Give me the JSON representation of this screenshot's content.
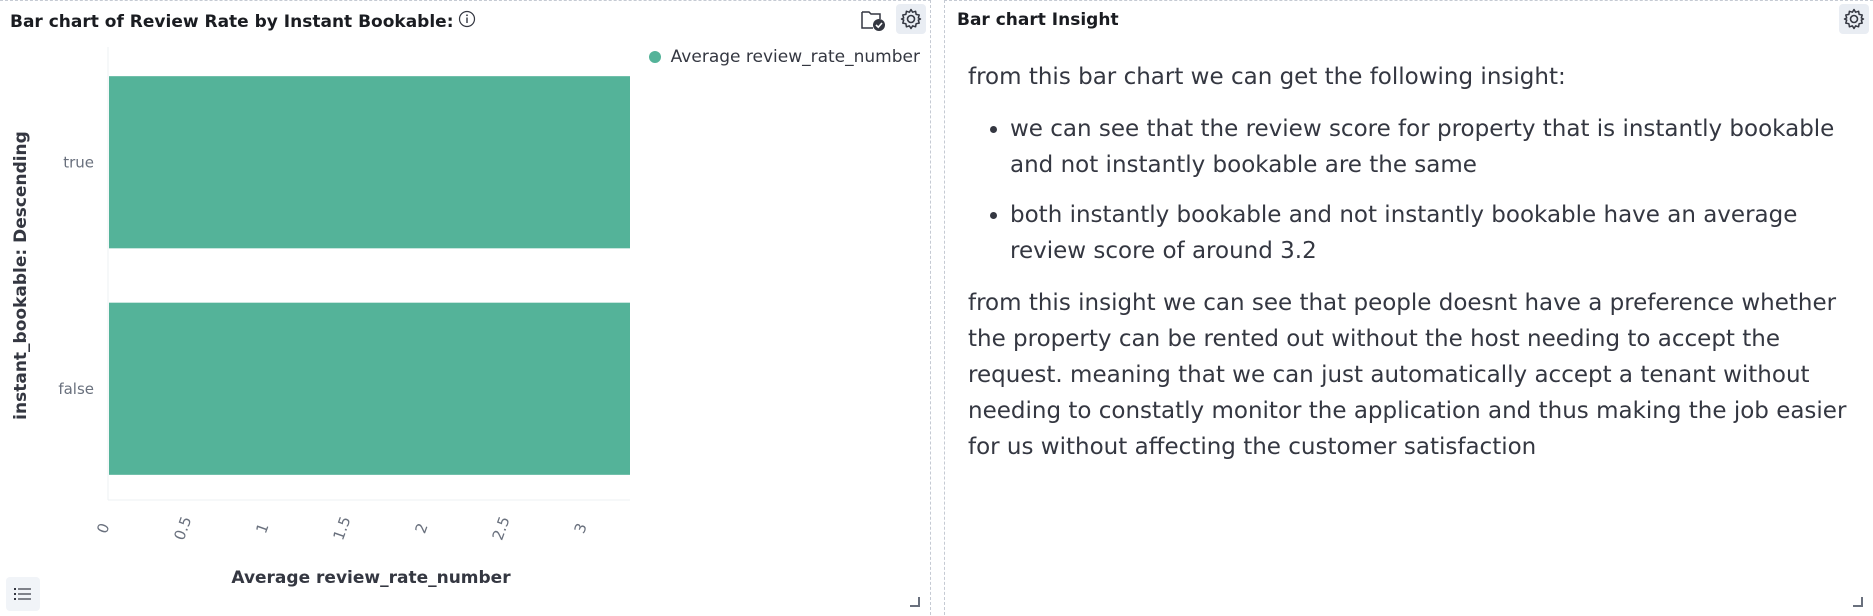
{
  "left_panel": {
    "title": "Bar chart of Review Rate by Instant Bookable:",
    "info_icon": "info-circle-icon",
    "folder_icon": "folder-check-icon",
    "gear_icon": "gear-icon",
    "list_icon": "list-icon"
  },
  "right_panel": {
    "title": "Bar chart Insight",
    "gear_icon": "gear-icon",
    "intro": "from this bar chart we can get the following insight:",
    "bullets": [
      "we can see that the review score for property that is instantly bookable and not instantly bookable are the same",
      "both instantly bookable and not instantly bookable have an average review score of around 3.2"
    ],
    "conclusion": "from this insight we can see that people doesnt have a preference whether the property can be rented out without the host needing to accept the request. meaning that we can just automatically accept a tenant without needing to constatly monitor the application and thus making the job easier for us without affecting the customer satisfaction"
  },
  "chart_data": {
    "type": "bar",
    "orientation": "horizontal",
    "categories": [
      "true",
      "false"
    ],
    "series": [
      {
        "name": "Average review_rate_number",
        "values": [
          3.28,
          3.28
        ]
      }
    ],
    "xlabel": "Average review_rate_number",
    "ylabel": "instant_bookable: Descending",
    "xlim": [
      0,
      3.28
    ],
    "xticks": [
      "0",
      "0.5",
      "1",
      "1.5",
      "2",
      "2.5",
      "3"
    ],
    "legend_position": "top-right",
    "grid": false,
    "colors": {
      "bar": "#54b399"
    }
  }
}
